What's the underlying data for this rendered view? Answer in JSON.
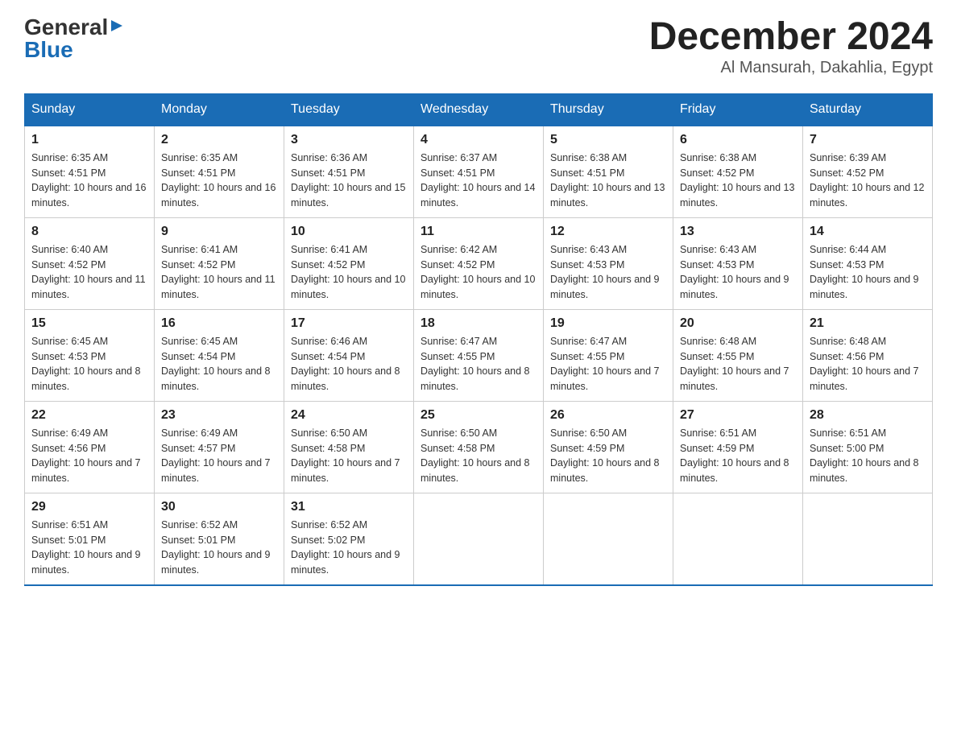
{
  "logo": {
    "general": "General",
    "blue": "Blue"
  },
  "title": {
    "month_year": "December 2024",
    "location": "Al Mansurah, Dakahlia, Egypt"
  },
  "days_of_week": [
    "Sunday",
    "Monday",
    "Tuesday",
    "Wednesday",
    "Thursday",
    "Friday",
    "Saturday"
  ],
  "weeks": [
    [
      {
        "day": "1",
        "sunrise": "6:35 AM",
        "sunset": "4:51 PM",
        "daylight": "10 hours and 16 minutes."
      },
      {
        "day": "2",
        "sunrise": "6:35 AM",
        "sunset": "4:51 PM",
        "daylight": "10 hours and 16 minutes."
      },
      {
        "day": "3",
        "sunrise": "6:36 AM",
        "sunset": "4:51 PM",
        "daylight": "10 hours and 15 minutes."
      },
      {
        "day": "4",
        "sunrise": "6:37 AM",
        "sunset": "4:51 PM",
        "daylight": "10 hours and 14 minutes."
      },
      {
        "day": "5",
        "sunrise": "6:38 AM",
        "sunset": "4:51 PM",
        "daylight": "10 hours and 13 minutes."
      },
      {
        "day": "6",
        "sunrise": "6:38 AM",
        "sunset": "4:52 PM",
        "daylight": "10 hours and 13 minutes."
      },
      {
        "day": "7",
        "sunrise": "6:39 AM",
        "sunset": "4:52 PM",
        "daylight": "10 hours and 12 minutes."
      }
    ],
    [
      {
        "day": "8",
        "sunrise": "6:40 AM",
        "sunset": "4:52 PM",
        "daylight": "10 hours and 11 minutes."
      },
      {
        "day": "9",
        "sunrise": "6:41 AM",
        "sunset": "4:52 PM",
        "daylight": "10 hours and 11 minutes."
      },
      {
        "day": "10",
        "sunrise": "6:41 AM",
        "sunset": "4:52 PM",
        "daylight": "10 hours and 10 minutes."
      },
      {
        "day": "11",
        "sunrise": "6:42 AM",
        "sunset": "4:52 PM",
        "daylight": "10 hours and 10 minutes."
      },
      {
        "day": "12",
        "sunrise": "6:43 AM",
        "sunset": "4:53 PM",
        "daylight": "10 hours and 9 minutes."
      },
      {
        "day": "13",
        "sunrise": "6:43 AM",
        "sunset": "4:53 PM",
        "daylight": "10 hours and 9 minutes."
      },
      {
        "day": "14",
        "sunrise": "6:44 AM",
        "sunset": "4:53 PM",
        "daylight": "10 hours and 9 minutes."
      }
    ],
    [
      {
        "day": "15",
        "sunrise": "6:45 AM",
        "sunset": "4:53 PM",
        "daylight": "10 hours and 8 minutes."
      },
      {
        "day": "16",
        "sunrise": "6:45 AM",
        "sunset": "4:54 PM",
        "daylight": "10 hours and 8 minutes."
      },
      {
        "day": "17",
        "sunrise": "6:46 AM",
        "sunset": "4:54 PM",
        "daylight": "10 hours and 8 minutes."
      },
      {
        "day": "18",
        "sunrise": "6:47 AM",
        "sunset": "4:55 PM",
        "daylight": "10 hours and 8 minutes."
      },
      {
        "day": "19",
        "sunrise": "6:47 AM",
        "sunset": "4:55 PM",
        "daylight": "10 hours and 7 minutes."
      },
      {
        "day": "20",
        "sunrise": "6:48 AM",
        "sunset": "4:55 PM",
        "daylight": "10 hours and 7 minutes."
      },
      {
        "day": "21",
        "sunrise": "6:48 AM",
        "sunset": "4:56 PM",
        "daylight": "10 hours and 7 minutes."
      }
    ],
    [
      {
        "day": "22",
        "sunrise": "6:49 AM",
        "sunset": "4:56 PM",
        "daylight": "10 hours and 7 minutes."
      },
      {
        "day": "23",
        "sunrise": "6:49 AM",
        "sunset": "4:57 PM",
        "daylight": "10 hours and 7 minutes."
      },
      {
        "day": "24",
        "sunrise": "6:50 AM",
        "sunset": "4:58 PM",
        "daylight": "10 hours and 7 minutes."
      },
      {
        "day": "25",
        "sunrise": "6:50 AM",
        "sunset": "4:58 PM",
        "daylight": "10 hours and 8 minutes."
      },
      {
        "day": "26",
        "sunrise": "6:50 AM",
        "sunset": "4:59 PM",
        "daylight": "10 hours and 8 minutes."
      },
      {
        "day": "27",
        "sunrise": "6:51 AM",
        "sunset": "4:59 PM",
        "daylight": "10 hours and 8 minutes."
      },
      {
        "day": "28",
        "sunrise": "6:51 AM",
        "sunset": "5:00 PM",
        "daylight": "10 hours and 8 minutes."
      }
    ],
    [
      {
        "day": "29",
        "sunrise": "6:51 AM",
        "sunset": "5:01 PM",
        "daylight": "10 hours and 9 minutes."
      },
      {
        "day": "30",
        "sunrise": "6:52 AM",
        "sunset": "5:01 PM",
        "daylight": "10 hours and 9 minutes."
      },
      {
        "day": "31",
        "sunrise": "6:52 AM",
        "sunset": "5:02 PM",
        "daylight": "10 hours and 9 minutes."
      },
      {
        "day": "",
        "sunrise": "",
        "sunset": "",
        "daylight": ""
      },
      {
        "day": "",
        "sunrise": "",
        "sunset": "",
        "daylight": ""
      },
      {
        "day": "",
        "sunrise": "",
        "sunset": "",
        "daylight": ""
      },
      {
        "day": "",
        "sunrise": "",
        "sunset": "",
        "daylight": ""
      }
    ]
  ]
}
